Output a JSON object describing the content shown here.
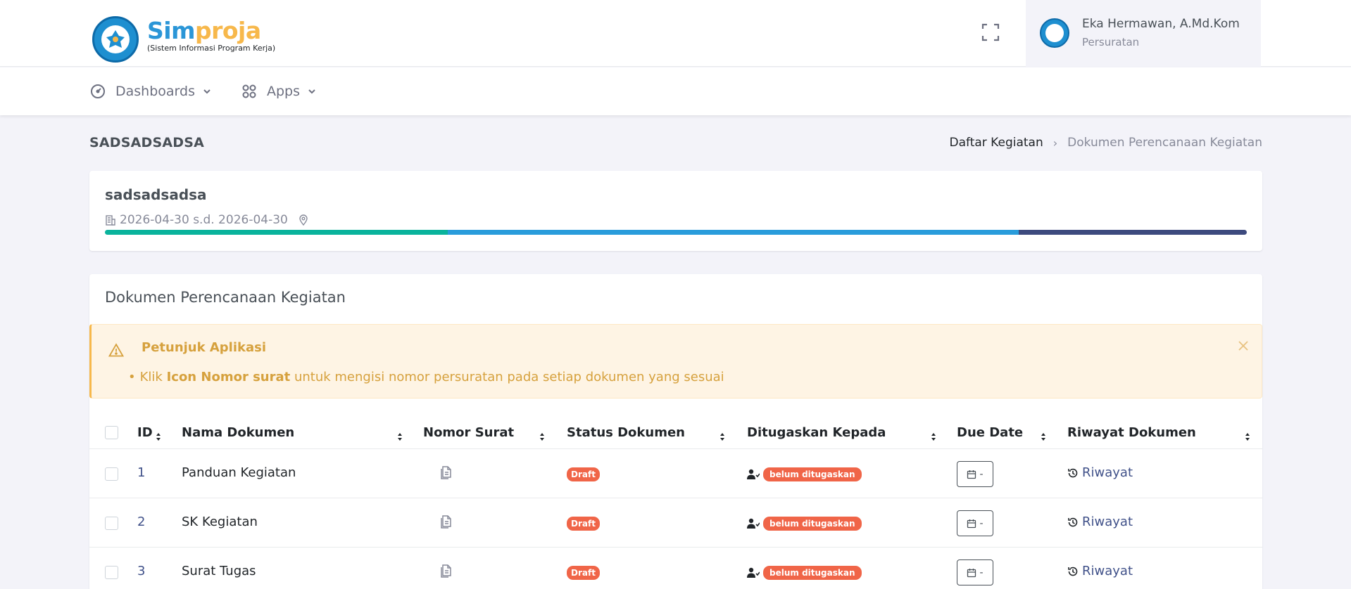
{
  "header": {
    "brand_sim": "Sim",
    "brand_proja": "proja",
    "brand_sub": "(Sistem Informasi Program Kerja)",
    "user_name": "Eka Hermawan, A.Md.Kom",
    "user_role": "Persuratan"
  },
  "nav": {
    "dashboards": "Dashboards",
    "apps": "Apps"
  },
  "page": {
    "title": "SADSADSADSA",
    "breadcrumb": [
      "Daftar Kegiatan",
      "Dokumen Perencanaan Kegiatan"
    ]
  },
  "activity": {
    "name": "sadsadsadsa",
    "date_range": "2026-04-30 s.d. 2026-04-30",
    "progress": [
      {
        "fraction": 0.3,
        "color": "#0ab39c"
      },
      {
        "fraction": 0.5,
        "color": "#299cdb"
      },
      {
        "fraction": 0.2,
        "color": "#3d4a7e"
      }
    ]
  },
  "documents": {
    "title": "Dokumen Perencanaan Kegiatan",
    "alert": {
      "title": "Petunjuk Aplikasi",
      "bullet_prefix": "Klik ",
      "bullet_bold": "Icon Nomor surat",
      "bullet_suffix": " untuk mengisi nomor persuratan pada setiap dokumen yang sesuai"
    },
    "columns": [
      "ID",
      "Nama Dokumen",
      "Nomor Surat",
      "Status Dokumen",
      "Ditugaskan Kepada",
      "Due Date",
      "Riwayat Dokumen"
    ],
    "rows": [
      {
        "id": "1",
        "name": "Panduan Kegiatan",
        "status": "Draft",
        "assigned": "belum ditugaskan",
        "due": "-",
        "history": "Riwayat"
      },
      {
        "id": "2",
        "name": "SK Kegiatan",
        "status": "Draft",
        "assigned": "belum ditugaskan",
        "due": "-",
        "history": "Riwayat"
      },
      {
        "id": "3",
        "name": "Surat Tugas",
        "status": "Draft",
        "assigned": "belum ditugaskan",
        "due": "-",
        "history": "Riwayat"
      }
    ]
  },
  "colors": {
    "primary": "#405189",
    "danger": "#f06548",
    "warning": "#f7b84b",
    "info": "#299cdb"
  }
}
